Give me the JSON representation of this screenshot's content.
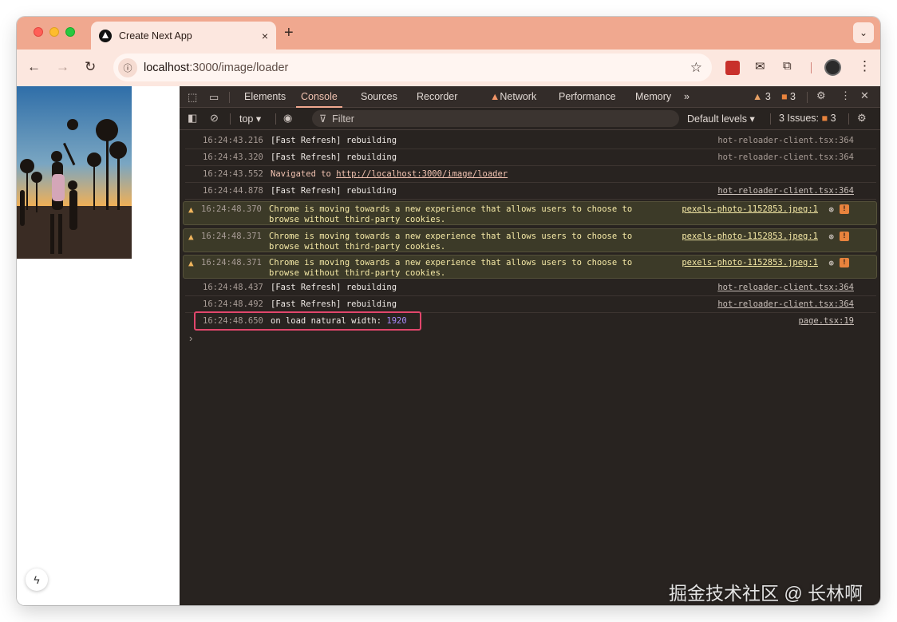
{
  "browser": {
    "tab_title": "Create Next App",
    "tab_close": "×",
    "new_tab": "+",
    "tab_search": "⌄",
    "url_host": "localhost",
    "url_path": ":3000/image/loader"
  },
  "devtools": {
    "tabs": [
      "Elements",
      "Console",
      "Sources",
      "Recorder",
      "Network",
      "Performance",
      "Memory"
    ],
    "more_tabs": "»",
    "warnings_count": "3",
    "errors_count": "3",
    "context": "top",
    "filter_placeholder": "Filter",
    "levels": "Default levels",
    "issues_label": "3 Issues:",
    "issues_count": "3"
  },
  "console": {
    "rows": [
      {
        "ts": "16:24:43.216",
        "msg": "[Fast Refresh] rebuilding",
        "src": "hot-reloader-client.tsx:364"
      },
      {
        "ts": "16:24:43.320",
        "msg": "[Fast Refresh] rebuilding",
        "src": "hot-reloader-client.tsx:364"
      },
      {
        "ts": "16:24:43.552",
        "msg_prefix": "Navigated to ",
        "link": "http://localhost:3000/image/loader"
      },
      {
        "ts": "16:24:44.878",
        "msg": "[Fast Refresh] rebuilding",
        "src": "hot-reloader-client.tsx:364"
      },
      {
        "ts": "16:24:48.370",
        "msg": "Chrome is moving towards a new experience that allows users to choose to\nbrowse without third-party cookies.",
        "src": "pexels-photo-1152853.jpeg:1"
      },
      {
        "ts": "16:24:48.371",
        "msg": "Chrome is moving towards a new experience that allows users to choose to\nbrowse without third-party cookies.",
        "src": "pexels-photo-1152853.jpeg:1"
      },
      {
        "ts": "16:24:48.371",
        "msg": "Chrome is moving towards a new experience that allows users to choose to\nbrowse without third-party cookies.",
        "src": "pexels-photo-1152853.jpeg:1"
      },
      {
        "ts": "16:24:48.437",
        "msg": "[Fast Refresh] rebuilding",
        "src": "hot-reloader-client.tsx:364"
      },
      {
        "ts": "16:24:48.492",
        "msg": "[Fast Refresh] rebuilding",
        "src": "hot-reloader-client.tsx:364"
      },
      {
        "ts": "16:24:48.650",
        "msg_prefix": "on load natural width: ",
        "value": "1920",
        "src": "page.tsx:19"
      }
    ],
    "prompt": "›"
  },
  "watermark": "掘金技术社区 @ 长林啊",
  "colors": {
    "tab_strip": "#f0a88f",
    "toolbar": "#fce7df",
    "devtools_bg": "#282320",
    "highlight": "#e2466c",
    "number": "#a78bfa"
  }
}
